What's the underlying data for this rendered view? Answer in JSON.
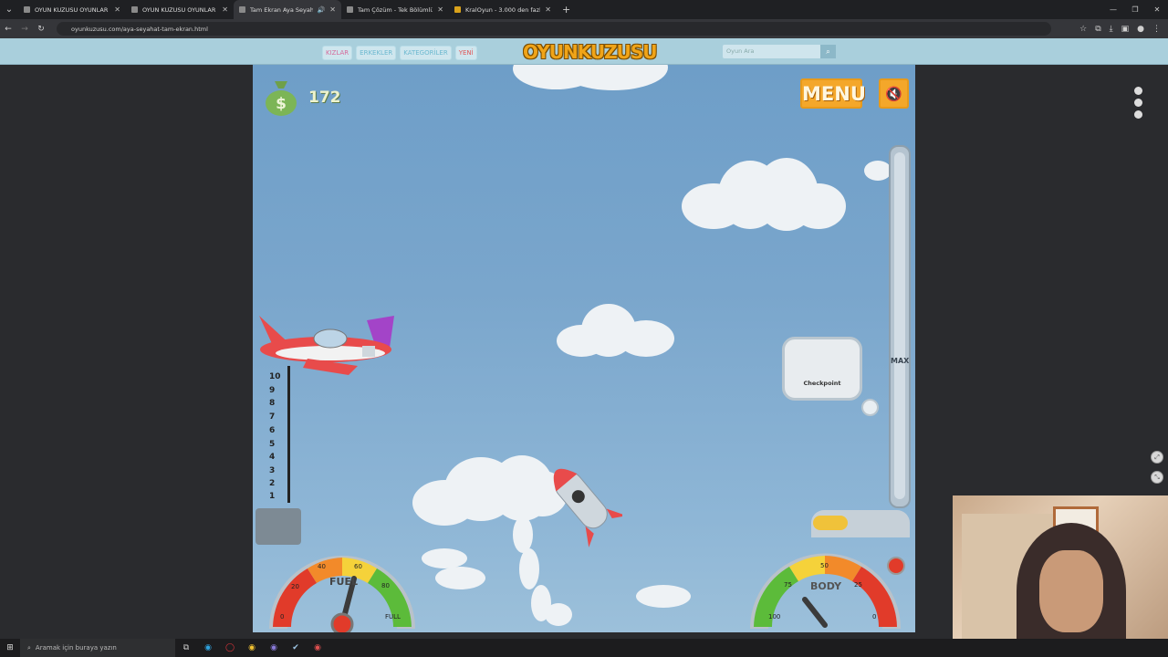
{
  "browser": {
    "tabs": [
      {
        "title": "OYUN KUZUSU OYUNLAR ++",
        "active": false
      },
      {
        "title": "OYUN KUZUSU OYUNLAR ++",
        "active": false
      },
      {
        "title": "Tam Ekran Aya Seyahat Oy",
        "active": true
      },
      {
        "title": "Tam Çözüm - Tek Bölümlük Oy",
        "active": false
      },
      {
        "title": "KralOyun - 3.000 den fazla onl",
        "active": false
      }
    ],
    "url": "oyunkuzusu.com/aya-seyahat-tam-ekran.html"
  },
  "site": {
    "nav": [
      "KIZLAR",
      "ERKEKLER",
      "KATEGORİLER",
      "YENİ"
    ],
    "logo": "OYUNKUZUSU",
    "search_placeholder": "Oyun Ara"
  },
  "game": {
    "money": "172",
    "menu_label": "MENU",
    "altitude_max_label": "MAX",
    "checkpoint_label": "Checkpoint",
    "ruler_numbers": [
      "10",
      "9",
      "8",
      "7",
      "6",
      "5",
      "4",
      "3",
      "2",
      "1"
    ],
    "fuel_gauge": {
      "label": "FUEL",
      "ticks": [
        "0",
        "20",
        "40",
        "60",
        "80",
        "FULL"
      ]
    },
    "body_gauge": {
      "label": "BODY",
      "ticks": [
        "100",
        "75",
        "50",
        "25",
        "0"
      ]
    }
  },
  "taskbar": {
    "search_placeholder": "Aramak için buraya yazın"
  }
}
